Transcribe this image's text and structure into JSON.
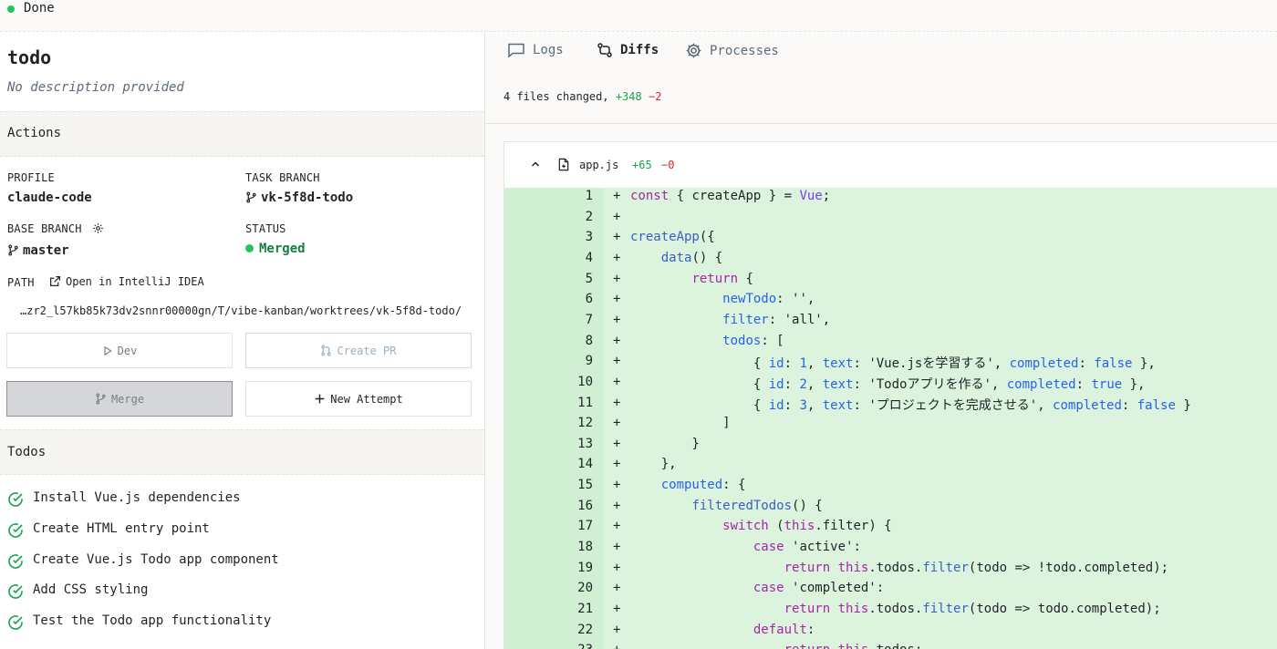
{
  "status_bar": {
    "label": "Done"
  },
  "task": {
    "title": "todo",
    "description": "No description provided"
  },
  "actions": {
    "heading": "Actions",
    "profile_label": "PROFILE",
    "profile_value": "claude-code",
    "task_branch_label": "TASK BRANCH",
    "task_branch_value": "vk-5f8d-todo",
    "base_branch_label": "BASE BRANCH",
    "base_branch_value": "master",
    "status_label": "STATUS",
    "status_value": "Merged",
    "path_label": "PATH",
    "open_in_label": "Open in IntelliJ IDEA",
    "path_value": "…zr2_l57kb85k73dv2snnr00000gn/T/vibe-kanban/worktrees/vk-5f8d-todo/",
    "dev_button": "Dev",
    "create_pr_button": "Create PR",
    "merge_button": "Merge",
    "new_attempt_button": "New Attempt"
  },
  "todos": {
    "heading": "Todos",
    "items": [
      "Install Vue.js dependencies",
      "Create HTML entry point",
      "Create Vue.js Todo app component",
      "Add CSS styling",
      "Test the Todo app functionality"
    ]
  },
  "tabs": {
    "logs": "Logs",
    "diffs": "Diffs",
    "processes": "Processes",
    "active": "Diffs"
  },
  "diff_summary": {
    "files_changed": "4 files changed,",
    "additions": "+348",
    "deletions": "−2"
  },
  "file": {
    "name": "app.js",
    "additions": "+65",
    "deletions": "−0"
  },
  "colors": {
    "status_green": "#22c55e",
    "added_bg": "#dcf4de",
    "add_text": "#16a34a",
    "del_text": "#dc2626"
  },
  "code_lines": [
    "const { createApp } = Vue;",
    "",
    "createApp({",
    "    data() {",
    "        return {",
    "            newTodo: '',",
    "            filter: 'all',",
    "            todos: [",
    "                { id: 1, text: 'Vue.jsを学習する', completed: false },",
    "                { id: 2, text: 'Todoアプリを作る', completed: true },",
    "                { id: 3, text: 'プロジェクトを完成させる', completed: false }",
    "            ]",
    "        }",
    "    },",
    "    computed: {",
    "        filteredTodos() {",
    "            switch (this.filter) {",
    "                case 'active':",
    "                    return this.todos.filter(todo => !todo.completed);",
    "                case 'completed':",
    "                    return this.todos.filter(todo => todo.completed);",
    "                default:",
    "                    return this.todos;"
  ]
}
